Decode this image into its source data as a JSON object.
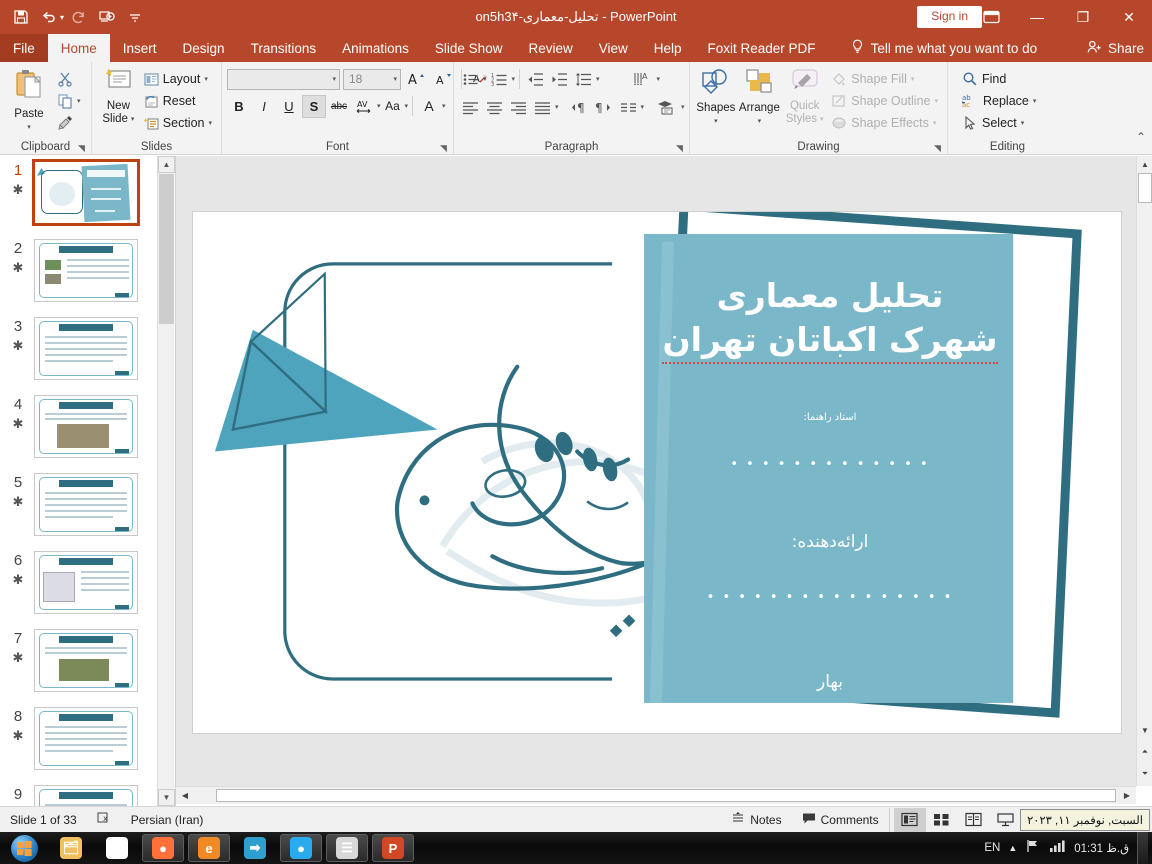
{
  "window": {
    "title": "on5h3تحلیل-معماری-۴  -  PowerPoint",
    "signin": "Sign in",
    "minimize": "—",
    "restore": "❐",
    "close": "✕",
    "ribbon_display_icon": "ribbon-display-options-icon"
  },
  "qat": [
    {
      "name": "save-icon",
      "glyph": "💾"
    },
    {
      "name": "undo-icon",
      "glyph": "↶"
    },
    {
      "name": "redo-icon",
      "glyph": "↻"
    },
    {
      "name": "start-presentation-icon",
      "glyph": "▷"
    },
    {
      "name": "customize-qat-icon",
      "glyph": "⌄"
    }
  ],
  "tabs": [
    {
      "label": "File",
      "active": false,
      "file": true
    },
    {
      "label": "Home",
      "active": true,
      "file": false
    },
    {
      "label": "Insert",
      "active": false,
      "file": false
    },
    {
      "label": "Design",
      "active": false,
      "file": false
    },
    {
      "label": "Transitions",
      "active": false,
      "file": false
    },
    {
      "label": "Animations",
      "active": false,
      "file": false
    },
    {
      "label": "Slide Show",
      "active": false,
      "file": false
    },
    {
      "label": "Review",
      "active": false,
      "file": false
    },
    {
      "label": "View",
      "active": false,
      "file": false
    },
    {
      "label": "Help",
      "active": false,
      "file": false
    },
    {
      "label": "Foxit Reader PDF",
      "active": false,
      "file": false
    }
  ],
  "tellme": "Tell me what you want to do",
  "share": "Share",
  "ribbon": {
    "clipboard": {
      "label": "Clipboard",
      "paste": "Paste",
      "cut": "Cut",
      "copy": "Copy",
      "format_painter": "Format Painter"
    },
    "slides": {
      "label": "Slides",
      "new_slide_line1": "New",
      "new_slide_line2": "Slide",
      "layout": "Layout",
      "reset": "Reset",
      "section": "Section"
    },
    "font": {
      "label": "Font",
      "font_name": "",
      "font_name_placeholder": "",
      "font_size": "18",
      "bold": "B",
      "italic": "I",
      "underline": "U",
      "shadow": "S",
      "strikethrough": "abc",
      "char_spacing": "AV",
      "change_case": "Aa",
      "font_color": "A",
      "increase_size": "A",
      "decrease_size": "A",
      "clear_formatting": "clear-formatting-icon"
    },
    "paragraph": {
      "label": "Paragraph",
      "bullets": "bullets-icon",
      "numbering": "numbering-icon",
      "decrease_indent": "decrease-indent-icon",
      "increase_indent": "increase-indent-icon",
      "line_spacing": "line-spacing-icon",
      "align_left": "align-left-icon",
      "align_center": "align-center-icon",
      "align_right": "align-right-icon",
      "justify": "justify-icon",
      "ltr": "left-to-right-icon",
      "rtl": "right-to-left-icon",
      "columns": "columns-icon",
      "text_direction": "text-direction-icon",
      "align_text": "align-text-icon",
      "smartart": "convert-to-smartart-icon"
    },
    "drawing": {
      "label": "Drawing",
      "shapes": "Shapes",
      "arrange": "Arrange",
      "quick_styles_line1": "Quick",
      "quick_styles_line2": "Styles",
      "shape_fill": "Shape Fill",
      "shape_outline": "Shape Outline",
      "shape_effects": "Shape Effects"
    },
    "editing": {
      "label": "Editing",
      "find": "Find",
      "replace": "Replace",
      "select": "Select"
    },
    "collapse_ribbon": "collapse-ribbon-icon"
  },
  "thumbnails": [
    {
      "number": "1",
      "selected": true,
      "star": "✱",
      "kind": "title"
    },
    {
      "number": "2",
      "selected": false,
      "star": "✱",
      "kind": "text-images"
    },
    {
      "number": "3",
      "selected": false,
      "star": "✱",
      "kind": "text"
    },
    {
      "number": "4",
      "selected": false,
      "star": "✱",
      "kind": "text-photo"
    },
    {
      "number": "5",
      "selected": false,
      "star": "✱",
      "kind": "text"
    },
    {
      "number": "6",
      "selected": false,
      "star": "✱",
      "kind": "plan"
    },
    {
      "number": "7",
      "selected": false,
      "star": "✱",
      "kind": "aerial"
    },
    {
      "number": "8",
      "selected": false,
      "star": "✱",
      "kind": "text"
    },
    {
      "number": "9",
      "selected": false,
      "star": "",
      "kind": "text"
    }
  ],
  "slide": {
    "title_line1": "تحلیل معماری",
    "title_line2": "شهرک اکباتان تهران",
    "advisor_label": "استاد راهنما:",
    "advisor_dots": "• • • • • • • • • • • • •",
    "presenter_label": "ارائه‌دهنده:",
    "presenter_dots": "• • • • • • • • • • • • • • • •",
    "season": "بهار",
    "calligraphy": "بسم الله الرحمن الرحیم",
    "colors": {
      "panel": "#7ab8c9",
      "frame": "#2f6e80",
      "triangle": "#4ea3bd",
      "title_text": "#ffffff"
    }
  },
  "statusbar": {
    "slide_count": "Slide 1 of 33",
    "spellcheck_icon": "spell-check-icon",
    "language": "Persian (Iran)",
    "notes": "Notes",
    "comments": "Comments",
    "view_normal": "normal-view-icon",
    "view_sorter": "slide-sorter-icon",
    "view_reading": "reading-view-icon",
    "view_slideshow": "slideshow-icon",
    "zoom_out": "−",
    "zoom_in": "+",
    "date_tooltip": "السبت, نوفمبر ١١, ٢٠٢٣"
  },
  "taskbar": {
    "start": "start-orb-icon",
    "items": [
      {
        "name": "file-explorer-icon",
        "glyph": "🗂",
        "color": "#f0c060",
        "open": false
      },
      {
        "name": "google-chrome-icon",
        "glyph": "●",
        "color": "#ffffff",
        "open": false
      },
      {
        "name": "firefox-icon",
        "glyph": "●",
        "color": "#ff7139",
        "open": true
      },
      {
        "name": "browser-icon",
        "glyph": "e",
        "color": "#f08a24",
        "open": true
      },
      {
        "name": "share-app-icon",
        "glyph": "➡",
        "color": "#2f9fd0",
        "open": false
      },
      {
        "name": "telegram-icon",
        "glyph": "●",
        "color": "#2aabee",
        "open": true
      },
      {
        "name": "notes-app-icon",
        "glyph": "☰",
        "color": "#d8d8d8",
        "open": true
      },
      {
        "name": "powerpoint-icon",
        "glyph": "P",
        "color": "#d24726",
        "open": true
      }
    ],
    "tray": {
      "language": "EN",
      "show_hidden": "▲",
      "network_icon": "network-icon",
      "signal_icon": "signal-bars-icon",
      "clock": "01:31 ق.ظ"
    }
  }
}
